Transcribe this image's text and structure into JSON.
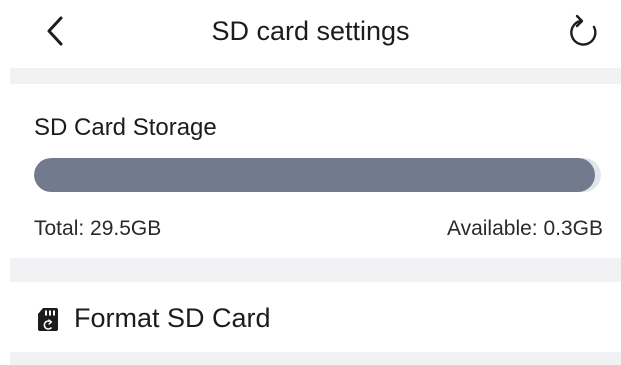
{
  "header": {
    "title": "SD card settings",
    "back_icon": "chevron-left-icon",
    "refresh_icon": "refresh-icon"
  },
  "storage": {
    "label": "SD Card Storage",
    "total_text": "Total: 29.5GB",
    "available_text": "Available: 0.3GB",
    "used_fraction": 0.99,
    "bar_color": "#727b8e",
    "bar_track_color": "#e4e5ea"
  },
  "format": {
    "label": "Format SD Card",
    "icon": "sd-card-icon"
  }
}
